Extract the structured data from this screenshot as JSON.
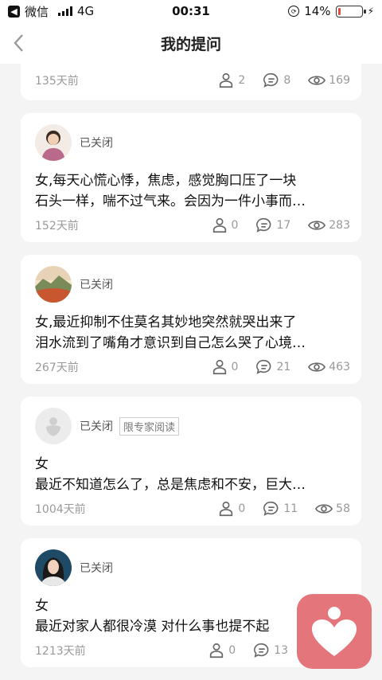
{
  "status_bar": {
    "carrier": "微信",
    "network": "4G",
    "time": "00:31",
    "battery": "14%"
  },
  "nav": {
    "title": "我的提问"
  },
  "cards": [
    {
      "ago": "135天前",
      "likes": "2",
      "comments": "8",
      "views": "169"
    },
    {
      "status": "已关闭",
      "line1": "女,每天心慌心悸，焦虑，感觉胸口压了一块",
      "line2": "石头一样，喘不过气来。会因为一件小事而…",
      "ago": "152天前",
      "likes": "0",
      "comments": "17",
      "views": "283"
    },
    {
      "status": "已关闭",
      "line1": "女,最近抑制不住莫名其妙地突然就哭出来了",
      "line2": "泪水流到了嘴角才意识到自己怎么哭了心境…",
      "ago": "267天前",
      "likes": "0",
      "comments": "21",
      "views": "463"
    },
    {
      "status": "已关闭",
      "tag": "限专家阅读",
      "line1": "女",
      "line2": "最近不知道怎么了，总是焦虑和不安，巨大…",
      "ago": "1004天前",
      "likes": "0",
      "comments": "11",
      "views": "58"
    },
    {
      "status": "已关闭",
      "line1": "女",
      "line2": "最近对家人都很冷漠 对什么事也提不起",
      "ago": "1213天前",
      "likes": "0",
      "comments": "13"
    }
  ],
  "colors": {
    "accent": "#e4757b",
    "battery_low": "#e74c3c"
  }
}
